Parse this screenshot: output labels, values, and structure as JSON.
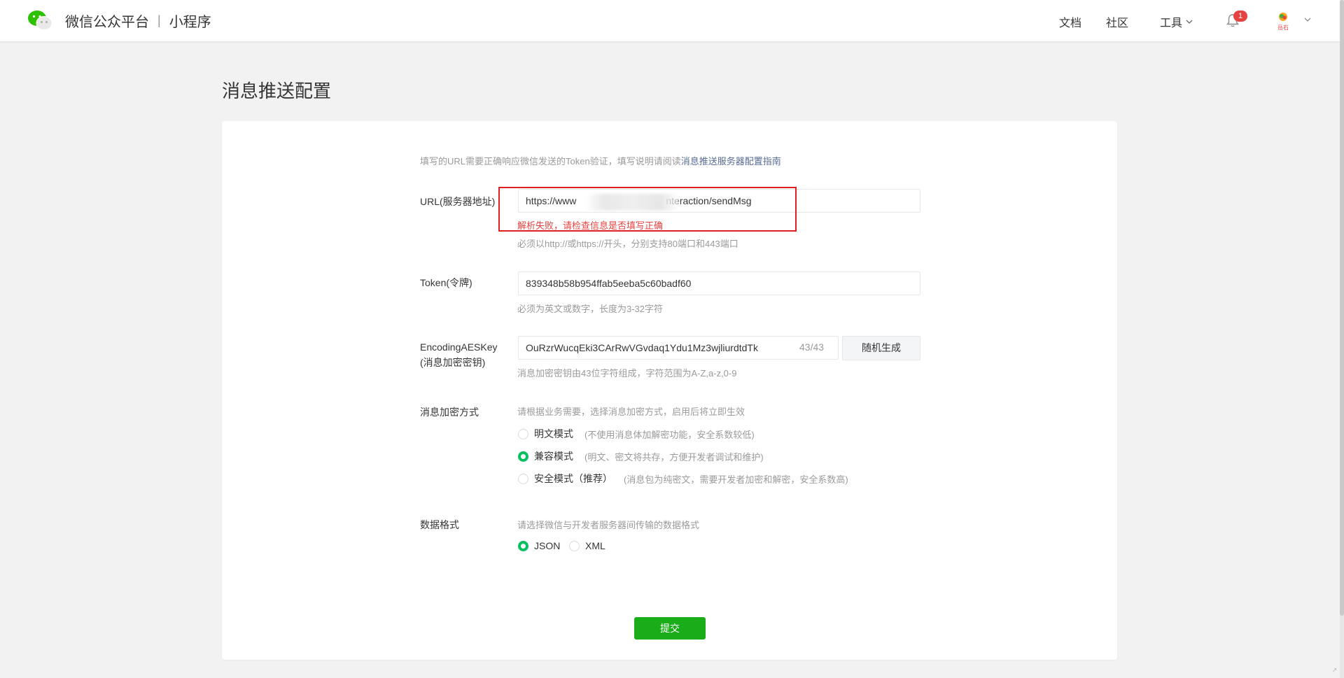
{
  "header": {
    "brand_name": "微信公众平台",
    "brand_separator": "|",
    "product_name": "小程序",
    "nav": {
      "docs": "文档",
      "community": "社区",
      "tools": "工具"
    },
    "notification_count": "1",
    "avatar_text": "岳石"
  },
  "page": {
    "title": "消息推送配置",
    "intro_text": "填写的URL需要正确响应微信发送的Token验证，填写说明请阅读",
    "intro_link": "消息推送服务器配置指南"
  },
  "form": {
    "url": {
      "label": "URL(服务器地址)",
      "value_start": "https://www",
      "value_end": "nteraction/sendMsg",
      "error": "解析失败，请检查信息是否填写正确",
      "hint": "必须以http://或https://开头，分别支持80端口和443端口"
    },
    "token": {
      "label": "Token(令牌)",
      "value": "839348b58b954ffab5eeba5c60badf60",
      "hint": "必须为英文或数字，长度为3-32字符"
    },
    "aes_key": {
      "label_line1": "EncodingAESKey",
      "label_line2": "(消息加密密钥)",
      "value": "OuRzrWucqEki3CArRwVGvdaq1Ydu1Mz3wjliurdtdTk",
      "count": "43/43",
      "generate_label": "随机生成",
      "hint": "消息加密密钥由43位字符组成，字符范围为A-Z,a-z,0-9"
    },
    "encryption": {
      "label": "消息加密方式",
      "hint": "请根据业务需要，选择消息加密方式，启用后将立即生效",
      "options": [
        {
          "label": "明文模式",
          "desc": "(不使用消息体加解密功能，安全系数较低)",
          "checked": false
        },
        {
          "label": "兼容模式",
          "desc": "(明文、密文将共存，方便开发者调试和维护)",
          "checked": true
        },
        {
          "label": "安全模式（推荐）",
          "desc": "(消息包为纯密文，需要开发者加密和解密，安全系数高)",
          "checked": false
        }
      ]
    },
    "data_format": {
      "label": "数据格式",
      "hint": "请选择微信与开发者服务器间传输的数据格式",
      "options": [
        {
          "label": "JSON",
          "checked": true
        },
        {
          "label": "XML",
          "checked": false
        }
      ]
    },
    "submit_label": "提交"
  },
  "colors": {
    "accent_green": "#1aad19",
    "radio_green": "#07c160",
    "error_red": "#e64340",
    "link_blue": "#576b95"
  }
}
